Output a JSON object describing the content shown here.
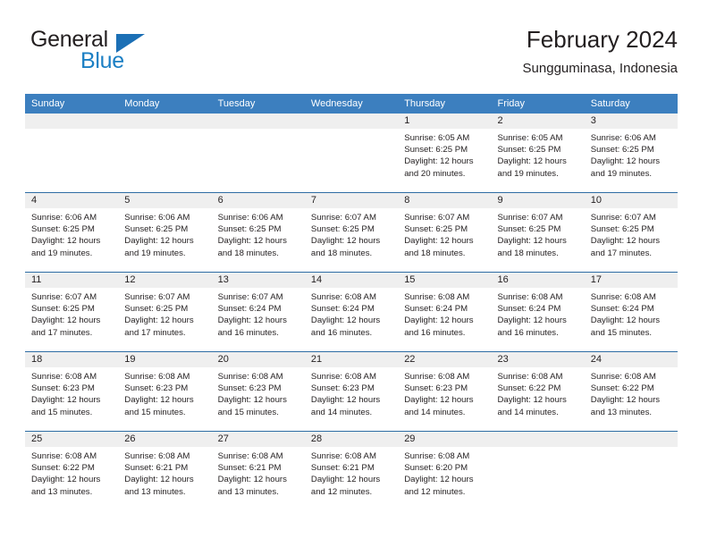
{
  "brand": {
    "word1": "General",
    "word2": "Blue",
    "triangle_color": "#1b6fb5",
    "blue_color": "#1b7fc4",
    "logo_name": "general-blue-logo"
  },
  "header": {
    "title": "February 2024",
    "subtitle": "Sungguminasa, Indonesia"
  },
  "theme": {
    "header_blue": "#3c7fbf",
    "row_rule_blue": "#2e6da4",
    "daynum_band": "#efefef",
    "text": "#231f20"
  },
  "calendar": {
    "weekday_headers": [
      "Sunday",
      "Monday",
      "Tuesday",
      "Wednesday",
      "Thursday",
      "Friday",
      "Saturday"
    ],
    "weeks": [
      [
        {
          "day": "",
          "lines": []
        },
        {
          "day": "",
          "lines": []
        },
        {
          "day": "",
          "lines": []
        },
        {
          "day": "",
          "lines": []
        },
        {
          "day": "1",
          "lines": [
            "Sunrise: 6:05 AM",
            "Sunset: 6:25 PM",
            "Daylight: 12 hours",
            "and 20 minutes."
          ]
        },
        {
          "day": "2",
          "lines": [
            "Sunrise: 6:05 AM",
            "Sunset: 6:25 PM",
            "Daylight: 12 hours",
            "and 19 minutes."
          ]
        },
        {
          "day": "3",
          "lines": [
            "Sunrise: 6:06 AM",
            "Sunset: 6:25 PM",
            "Daylight: 12 hours",
            "and 19 minutes."
          ]
        }
      ],
      [
        {
          "day": "4",
          "lines": [
            "Sunrise: 6:06 AM",
            "Sunset: 6:25 PM",
            "Daylight: 12 hours",
            "and 19 minutes."
          ]
        },
        {
          "day": "5",
          "lines": [
            "Sunrise: 6:06 AM",
            "Sunset: 6:25 PM",
            "Daylight: 12 hours",
            "and 19 minutes."
          ]
        },
        {
          "day": "6",
          "lines": [
            "Sunrise: 6:06 AM",
            "Sunset: 6:25 PM",
            "Daylight: 12 hours",
            "and 18 minutes."
          ]
        },
        {
          "day": "7",
          "lines": [
            "Sunrise: 6:07 AM",
            "Sunset: 6:25 PM",
            "Daylight: 12 hours",
            "and 18 minutes."
          ]
        },
        {
          "day": "8",
          "lines": [
            "Sunrise: 6:07 AM",
            "Sunset: 6:25 PM",
            "Daylight: 12 hours",
            "and 18 minutes."
          ]
        },
        {
          "day": "9",
          "lines": [
            "Sunrise: 6:07 AM",
            "Sunset: 6:25 PM",
            "Daylight: 12 hours",
            "and 18 minutes."
          ]
        },
        {
          "day": "10",
          "lines": [
            "Sunrise: 6:07 AM",
            "Sunset: 6:25 PM",
            "Daylight: 12 hours",
            "and 17 minutes."
          ]
        }
      ],
      [
        {
          "day": "11",
          "lines": [
            "Sunrise: 6:07 AM",
            "Sunset: 6:25 PM",
            "Daylight: 12 hours",
            "and 17 minutes."
          ]
        },
        {
          "day": "12",
          "lines": [
            "Sunrise: 6:07 AM",
            "Sunset: 6:25 PM",
            "Daylight: 12 hours",
            "and 17 minutes."
          ]
        },
        {
          "day": "13",
          "lines": [
            "Sunrise: 6:07 AM",
            "Sunset: 6:24 PM",
            "Daylight: 12 hours",
            "and 16 minutes."
          ]
        },
        {
          "day": "14",
          "lines": [
            "Sunrise: 6:08 AM",
            "Sunset: 6:24 PM",
            "Daylight: 12 hours",
            "and 16 minutes."
          ]
        },
        {
          "day": "15",
          "lines": [
            "Sunrise: 6:08 AM",
            "Sunset: 6:24 PM",
            "Daylight: 12 hours",
            "and 16 minutes."
          ]
        },
        {
          "day": "16",
          "lines": [
            "Sunrise: 6:08 AM",
            "Sunset: 6:24 PM",
            "Daylight: 12 hours",
            "and 16 minutes."
          ]
        },
        {
          "day": "17",
          "lines": [
            "Sunrise: 6:08 AM",
            "Sunset: 6:24 PM",
            "Daylight: 12 hours",
            "and 15 minutes."
          ]
        }
      ],
      [
        {
          "day": "18",
          "lines": [
            "Sunrise: 6:08 AM",
            "Sunset: 6:23 PM",
            "Daylight: 12 hours",
            "and 15 minutes."
          ]
        },
        {
          "day": "19",
          "lines": [
            "Sunrise: 6:08 AM",
            "Sunset: 6:23 PM",
            "Daylight: 12 hours",
            "and 15 minutes."
          ]
        },
        {
          "day": "20",
          "lines": [
            "Sunrise: 6:08 AM",
            "Sunset: 6:23 PM",
            "Daylight: 12 hours",
            "and 15 minutes."
          ]
        },
        {
          "day": "21",
          "lines": [
            "Sunrise: 6:08 AM",
            "Sunset: 6:23 PM",
            "Daylight: 12 hours",
            "and 14 minutes."
          ]
        },
        {
          "day": "22",
          "lines": [
            "Sunrise: 6:08 AM",
            "Sunset: 6:23 PM",
            "Daylight: 12 hours",
            "and 14 minutes."
          ]
        },
        {
          "day": "23",
          "lines": [
            "Sunrise: 6:08 AM",
            "Sunset: 6:22 PM",
            "Daylight: 12 hours",
            "and 14 minutes."
          ]
        },
        {
          "day": "24",
          "lines": [
            "Sunrise: 6:08 AM",
            "Sunset: 6:22 PM",
            "Daylight: 12 hours",
            "and 13 minutes."
          ]
        }
      ],
      [
        {
          "day": "25",
          "lines": [
            "Sunrise: 6:08 AM",
            "Sunset: 6:22 PM",
            "Daylight: 12 hours",
            "and 13 minutes."
          ]
        },
        {
          "day": "26",
          "lines": [
            "Sunrise: 6:08 AM",
            "Sunset: 6:21 PM",
            "Daylight: 12 hours",
            "and 13 minutes."
          ]
        },
        {
          "day": "27",
          "lines": [
            "Sunrise: 6:08 AM",
            "Sunset: 6:21 PM",
            "Daylight: 12 hours",
            "and 13 minutes."
          ]
        },
        {
          "day": "28",
          "lines": [
            "Sunrise: 6:08 AM",
            "Sunset: 6:21 PM",
            "Daylight: 12 hours",
            "and 12 minutes."
          ]
        },
        {
          "day": "29",
          "lines": [
            "Sunrise: 6:08 AM",
            "Sunset: 6:20 PM",
            "Daylight: 12 hours",
            "and 12 minutes."
          ]
        },
        {
          "day": "",
          "lines": []
        },
        {
          "day": "",
          "lines": []
        }
      ]
    ]
  }
}
